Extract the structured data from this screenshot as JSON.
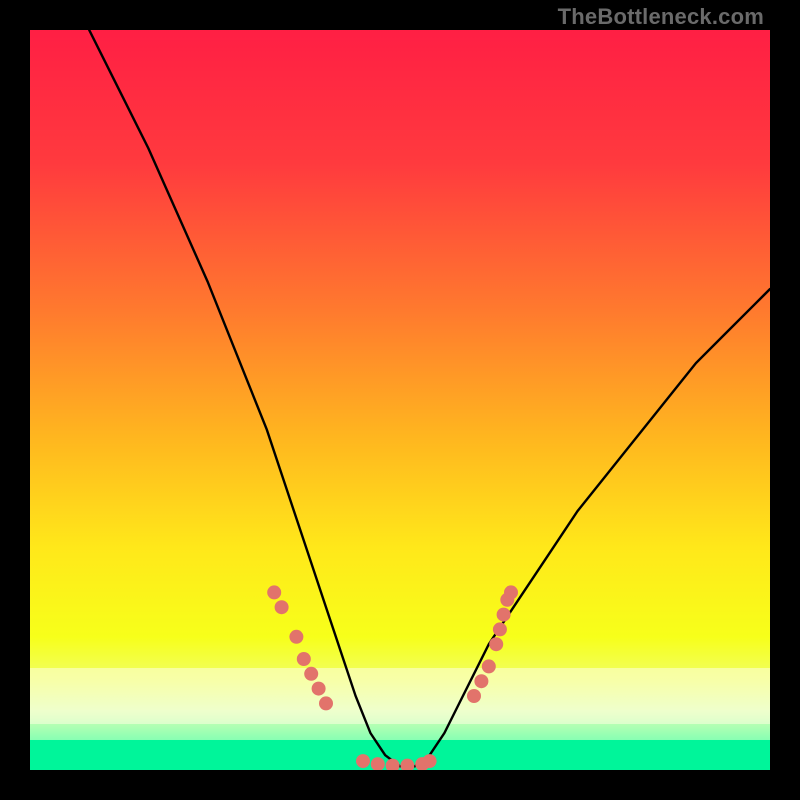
{
  "watermark": "TheBottleneck.com",
  "colors": {
    "frame": "#000000",
    "curve": "#000000",
    "markers": "#e2736b",
    "gradient_stops": [
      {
        "offset": 0.0,
        "color": "#ff1f44"
      },
      {
        "offset": 0.18,
        "color": "#ff3a3e"
      },
      {
        "offset": 0.38,
        "color": "#ff7a2e"
      },
      {
        "offset": 0.55,
        "color": "#ffb61f"
      },
      {
        "offset": 0.7,
        "color": "#ffe81a"
      },
      {
        "offset": 0.82,
        "color": "#f7ff1a"
      },
      {
        "offset": 0.88,
        "color": "#f0ff66"
      },
      {
        "offset": 0.92,
        "color": "#dcffb3"
      },
      {
        "offset": 0.96,
        "color": "#86ffb3"
      },
      {
        "offset": 1.0,
        "color": "#1cffb3"
      }
    ],
    "band_light": "#fdffe0",
    "band_green": "#00f59a"
  },
  "chart_data": {
    "type": "line",
    "title": "",
    "xlabel": "",
    "ylabel": "",
    "xlim": [
      0,
      100
    ],
    "ylim": [
      0,
      100
    ],
    "note": "Bottleneck curve; x ≈ relative component balance, y ≈ bottleneck % (higher = worse). Minimum ~0 near x≈47–53. Values estimated from pixels.",
    "series": [
      {
        "name": "bottleneck-curve",
        "x": [
          8,
          12,
          16,
          20,
          24,
          28,
          30,
          32,
          34,
          36,
          38,
          40,
          42,
          44,
          46,
          48,
          50,
          52,
          54,
          56,
          58,
          60,
          62,
          64,
          66,
          70,
          74,
          78,
          82,
          86,
          90,
          94,
          98,
          100
        ],
        "y": [
          100,
          92,
          84,
          75,
          66,
          56,
          51,
          46,
          40,
          34,
          28,
          22,
          16,
          10,
          5,
          2,
          0.5,
          0.5,
          2,
          5,
          9,
          13,
          17,
          20,
          23,
          29,
          35,
          40,
          45,
          50,
          55,
          59,
          63,
          65
        ]
      }
    ],
    "markers": {
      "name": "sample-points",
      "comment": "Salmon dots along the curve near the valley and shoulders (approx).",
      "points": [
        {
          "x": 33,
          "y": 24
        },
        {
          "x": 34,
          "y": 22
        },
        {
          "x": 36,
          "y": 18
        },
        {
          "x": 37,
          "y": 15
        },
        {
          "x": 38,
          "y": 13
        },
        {
          "x": 39,
          "y": 11
        },
        {
          "x": 40,
          "y": 9
        },
        {
          "x": 45,
          "y": 1.2
        },
        {
          "x": 47,
          "y": 0.8
        },
        {
          "x": 49,
          "y": 0.6
        },
        {
          "x": 51,
          "y": 0.6
        },
        {
          "x": 53,
          "y": 0.8
        },
        {
          "x": 54,
          "y": 1.2
        },
        {
          "x": 60,
          "y": 10
        },
        {
          "x": 61,
          "y": 12
        },
        {
          "x": 62,
          "y": 14
        },
        {
          "x": 63,
          "y": 17
        },
        {
          "x": 63.5,
          "y": 19
        },
        {
          "x": 64,
          "y": 21
        },
        {
          "x": 64.5,
          "y": 23
        },
        {
          "x": 65,
          "y": 24
        }
      ]
    }
  }
}
